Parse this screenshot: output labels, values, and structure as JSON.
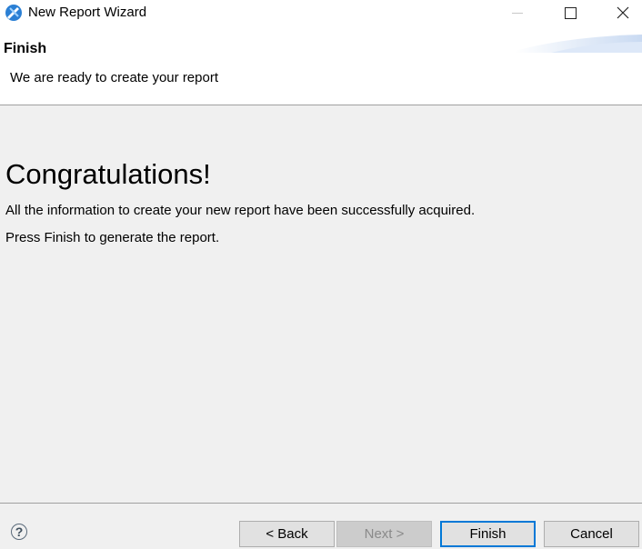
{
  "window": {
    "title": "New Report Wizard",
    "icon": "eclipse-birt-icon"
  },
  "header": {
    "heading": "Finish",
    "description": "We are ready to create your report"
  },
  "content": {
    "congrats": "Congratulations!",
    "message_line1": "All the information to create your new report have been successfully acquired.",
    "message_line2": "Press Finish to generate the report."
  },
  "footer": {
    "help_glyph": "?",
    "back_label": "< Back",
    "next_label": "Next >",
    "finish_label": "Finish",
    "cancel_label": "Cancel"
  },
  "colors": {
    "accent": "#0078d7",
    "content_bg": "#f0f0f0",
    "button_bg": "#e1e1e1"
  }
}
